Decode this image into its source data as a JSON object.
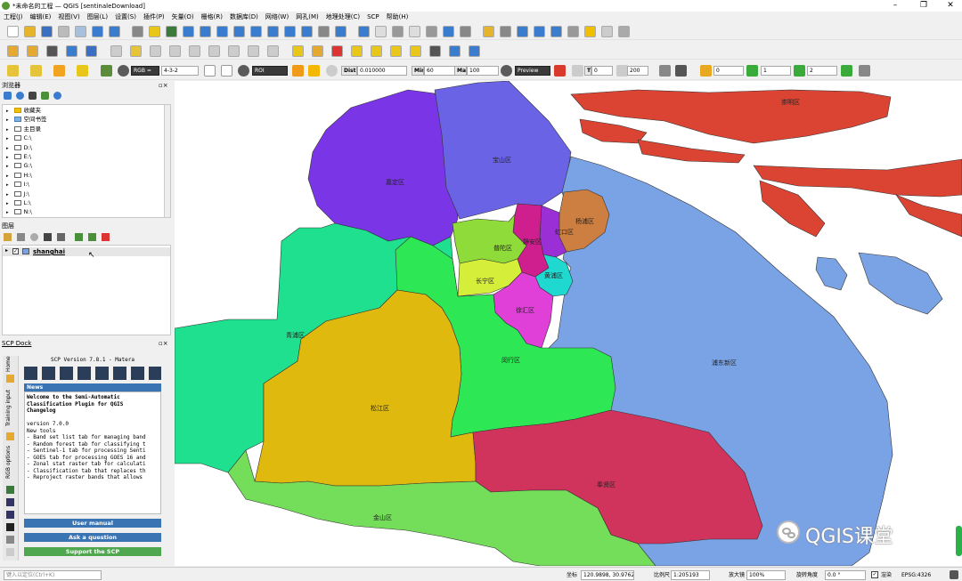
{
  "app": {
    "title": "*未命名的工程 — QGIS [sentinaleDownload]"
  },
  "menus": [
    "工程(J)",
    "编辑(E)",
    "视图(V)",
    "图层(L)",
    "设置(S)",
    "插件(P)",
    "矢量(O)",
    "栅格(R)",
    "数据库(D)",
    "网络(W)",
    "网孔(M)",
    "地理处理(C)",
    "SCP",
    "帮助(H)"
  ],
  "toolbar3": {
    "rgb": "RGB =",
    "rgb_value": "4-3-2",
    "roi": "ROI",
    "dist_label": "Dist",
    "dist_value": "0.010000",
    "min_label": "Min",
    "min_value": "60",
    "max_label": "Max",
    "max_value": "100",
    "preview": "Preview",
    "t_label": "T",
    "t_value": "0",
    "s_value": "200",
    "band_a": "0",
    "band_b": "1",
    "band_c": "2"
  },
  "browser": {
    "title": "浏览器",
    "items": [
      "收藏夹",
      "空间书签",
      "主目录",
      "C:\\",
      "D:\\",
      "E:\\",
      "G:\\",
      "H:\\",
      "I:\\",
      "J:\\",
      "L:\\",
      "N:\\"
    ]
  },
  "layers": {
    "title": "图层",
    "layer_name": "shanghai"
  },
  "scp": {
    "dock_title": "SCP Dock",
    "version": "SCP Version 7.8.1 - Matera",
    "tabs": [
      "Home",
      "Training input",
      "RGB options"
    ],
    "news_title": "News",
    "news_lines": [
      "Welcome to the Semi-Automatic",
      "Classification Plugin for QGIS",
      "Changelog",
      "",
      "version 7.0.0",
      "New tools",
      "- Band set list tab for managing band",
      "- Random forest tab for classifying t",
      "- Sentinel-1 tab for processing Senti",
      "- GOES tab for processing GOES 16 and",
      "- Zonal stat raster tab for calculati",
      "- Classification tab that replaces th",
      "- Reproject raster bands that allows "
    ],
    "btn_manual": "User manual",
    "btn_ask": "Ask a question",
    "btn_support": "Support the SCP"
  },
  "map": {
    "districts": [
      "崇明区",
      "宝山区",
      "嘉定区",
      "杨浦区",
      "虹口区",
      "普陀区",
      "静安区",
      "长宁区",
      "黄浦区",
      "徐汇区",
      "青浦区",
      "闵行区",
      "浦东新区",
      "松江区",
      "奉贤区",
      "金山区"
    ],
    "watermark": "QGIS课堂"
  },
  "status": {
    "search_placeholder": "键入以定位(Ctrl+K)",
    "coord_label": "坐标",
    "coord_value": "120.9898, 30.9762",
    "scale_label": "比例尺",
    "scale_value": "1:205193",
    "mag_label": "放大镜",
    "mag_value": "100%",
    "rot_label": "旋转角度",
    "rot_value": "0.0 °",
    "render_label": "渲染",
    "crs": "EPSG:4326"
  },
  "colors": {
    "chongming": "#db4433",
    "baoshan": "#6a63e6",
    "jiading": "#7a36e6",
    "yangpu": "#cd7f42",
    "hongkou": "#9a2fd6",
    "putuo": "#8fdb3a",
    "jingan": "#cf1f8f",
    "changning": "#d4ee3a",
    "huangpu": "#1fd8cf",
    "xuhui": "#e040d8",
    "qingpu": "#1fe08e",
    "minhang": "#2de854",
    "pudong": "#7aa3e6",
    "songjiang": "#dfb90d",
    "fengxian": "#d0345c",
    "jinshan": "#74dd5a"
  }
}
